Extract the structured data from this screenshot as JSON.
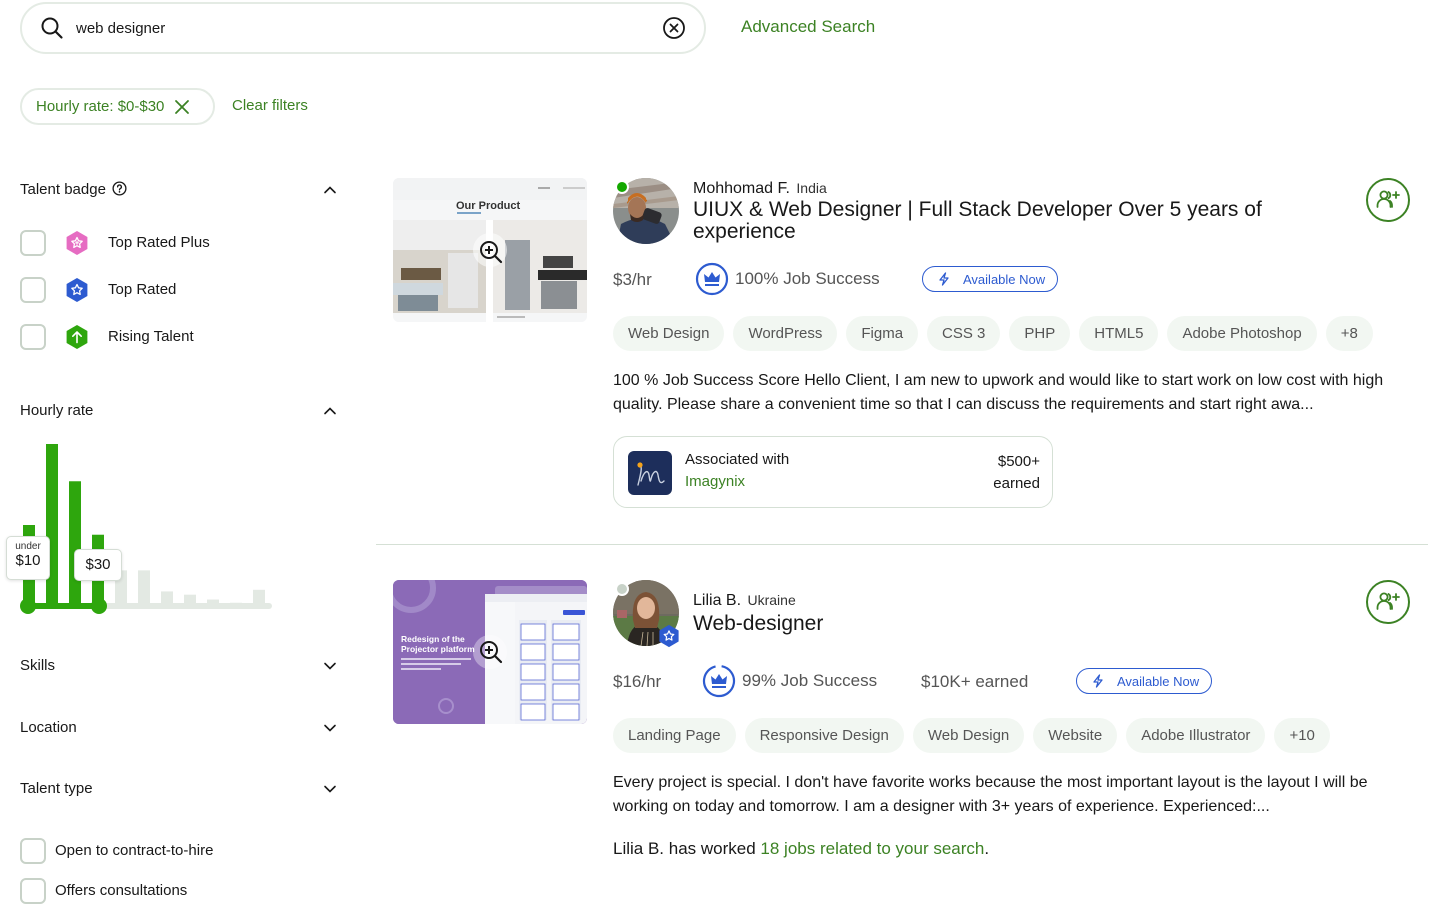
{
  "search": {
    "value": "web designer",
    "advanced_label": "Advanced Search"
  },
  "filters": {
    "active_chip": "Hourly rate: $0-$30",
    "clear_label": "Clear filters"
  },
  "sidebar": {
    "talent_badge": {
      "title": "Talent badge",
      "options": [
        {
          "label": "Top Rated Plus",
          "icon": "top-rated-plus-icon",
          "color": "#e66cc2",
          "checked": false
        },
        {
          "label": "Top Rated",
          "icon": "top-rated-icon",
          "color": "#2d5bd0",
          "checked": false
        },
        {
          "label": "Rising Talent",
          "icon": "rising-talent-icon",
          "color": "#2ea60d",
          "checked": false
        }
      ]
    },
    "hourly_rate": {
      "title": "Hourly rate",
      "min_label_small": "under",
      "min_label": "$10",
      "max_label": "$30",
      "histogram": {
        "selected_bars": [
          0.5,
          1.0,
          0.77,
          0.44
        ],
        "unselected_bars": [
          0.22,
          0.22,
          0.09,
          0.07,
          0.04,
          0.02,
          0.1
        ]
      }
    },
    "skills": {
      "title": "Skills"
    },
    "location": {
      "title": "Location"
    },
    "talent_type": {
      "title": "Talent type"
    },
    "extra_options": [
      {
        "label": "Open to contract-to-hire",
        "checked": false
      },
      {
        "label": "Offers consultations",
        "checked": false
      }
    ]
  },
  "results": [
    {
      "name": "Mohhomad F.",
      "country": "India",
      "title": "UIUX & Web Designer | Full Stack Developer Over 5 years of experience",
      "rate": "$3/hr",
      "job_success": "100% Job Success",
      "availability": "Available Now",
      "online": true,
      "portfolio_caption": "Our Product",
      "skills": [
        "Web Design",
        "WordPress",
        "Figma",
        "CSS 3",
        "PHP",
        "HTML5",
        "Adobe Photoshop",
        "+8"
      ],
      "description": "100 % Job Success Score Hello Client, I am new to upwork and would like to start work on low cost with high quality. Please share a convenient time so that I can discuss the requirements and start right awa...",
      "association": {
        "label": "Associated with",
        "agency": "Imagynix",
        "earned_amount": "$500+",
        "earned_label": "earned"
      }
    },
    {
      "name": "Lilia B.",
      "country": "Ukraine",
      "title": "Web-designer",
      "rate": "$16/hr",
      "job_success": "99% Job Success",
      "earned": "$10K+ earned",
      "availability": "Available Now",
      "online": false,
      "portfolio_caption": "Redesign of the Projector platform",
      "skills": [
        "Landing Page",
        "Responsive Design",
        "Web Design",
        "Website",
        "Adobe Illustrator",
        "+10"
      ],
      "description": "Every project is special. I don't have favorite works because the most important layout is the layout I will be working on today and tomorrow. I am a designer with 3+ years of experience. Experienced:...",
      "worked_prefix": "Lilia B. has worked ",
      "worked_link": "18 jobs related to your search",
      "worked_suffix": "."
    }
  ],
  "colors": {
    "brand_green": "#3c8224",
    "bar_green": "#2ea60d",
    "blue": "#2d5bd0",
    "border": "#e4ebe4"
  }
}
